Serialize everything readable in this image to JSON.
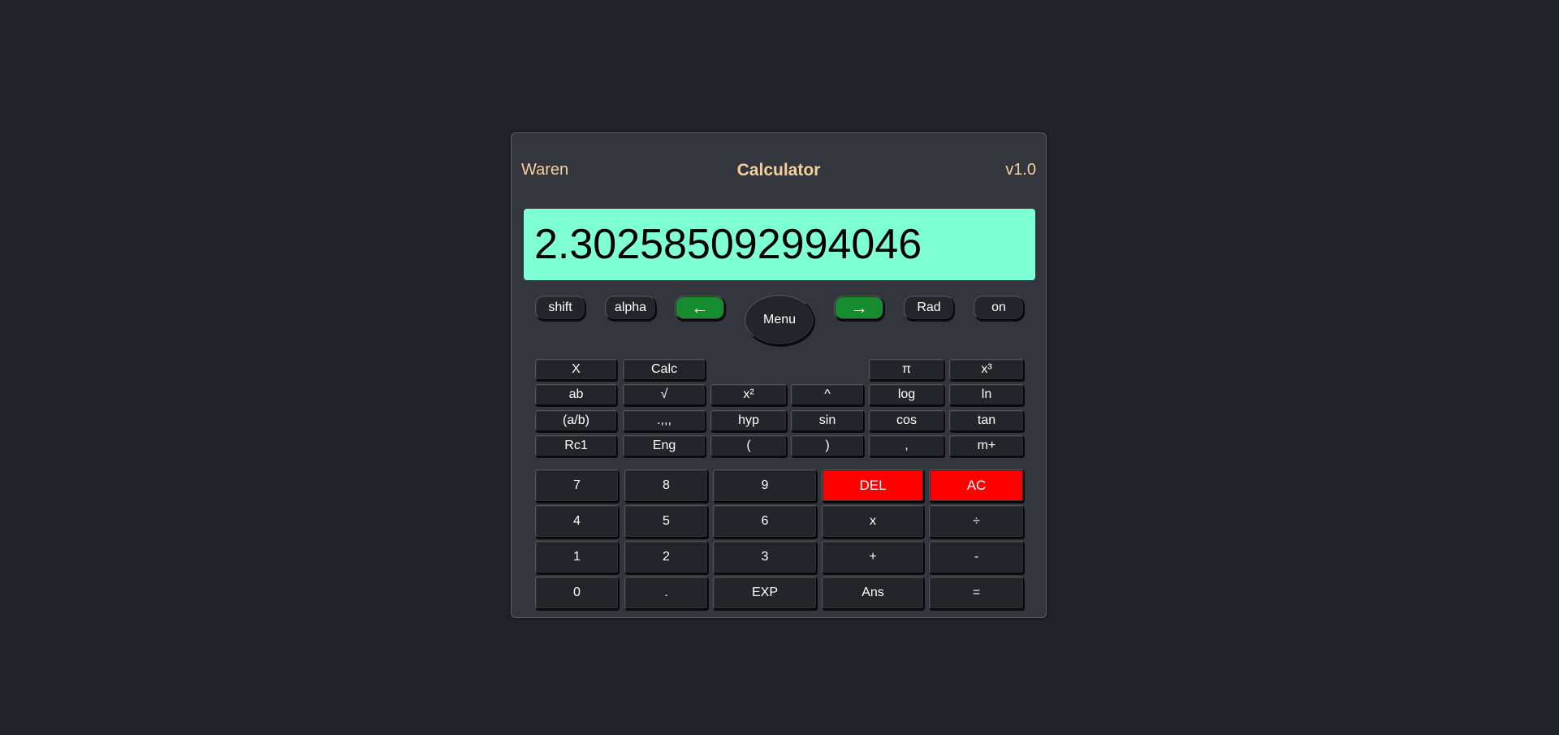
{
  "header": {
    "brand": "Waren",
    "title": "Calculator",
    "version": "v1.0"
  },
  "display": {
    "value": "2.302585092994046"
  },
  "top_row": {
    "shift": "shift",
    "alpha": "alpha",
    "left_arrow": "←",
    "menu": "Menu",
    "right_arrow": "→",
    "angle_mode": "Rad",
    "power": "on"
  },
  "sci_keys": {
    "row1": [
      "X",
      "Calc",
      "π",
      "x³"
    ],
    "row2": [
      "ab",
      "√",
      "x²",
      "^",
      "log",
      "ln"
    ],
    "row3": [
      "(a/b)",
      ".,,,",
      "hyp",
      "sin",
      "cos",
      "tan"
    ],
    "row4": [
      "Rc1",
      "Eng",
      "(",
      ")",
      ",",
      "m+"
    ]
  },
  "num_keys": {
    "row1": [
      "7",
      "8",
      "9",
      "DEL",
      "AC"
    ],
    "row2": [
      "4",
      "5",
      "6",
      "x",
      "÷"
    ],
    "row3": [
      "1",
      "2",
      "3",
      "+",
      "-"
    ],
    "row4": [
      "0",
      ".",
      "EXP",
      "Ans",
      "="
    ]
  },
  "colors": {
    "background": "#212328",
    "panel": "#33363d",
    "display": "#7fffd4",
    "header_text": "#f5cf9d",
    "arrow_keys": "#178c2e",
    "delete_keys": "#ff0000"
  }
}
